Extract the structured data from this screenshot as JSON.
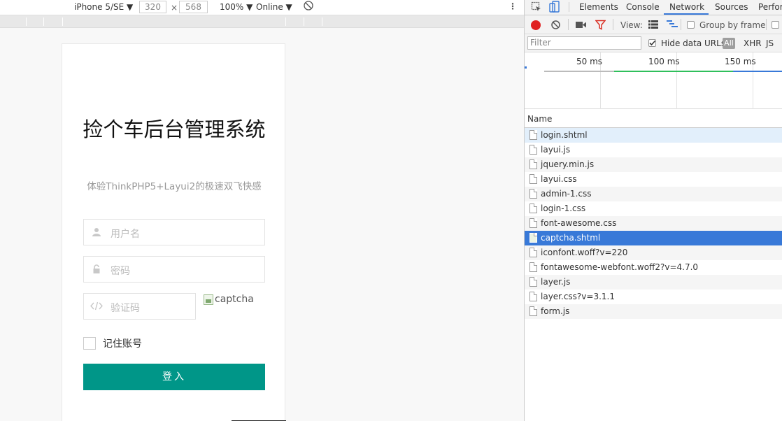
{
  "emulator": {
    "device": "iPhone 5/SE",
    "width": "320",
    "times": "×",
    "height": "568",
    "zoom": "100%",
    "network": "Online"
  },
  "login": {
    "title": "捡个车后台管理系统",
    "subtitle": "体验ThinkPHP5+Layui2的极速双飞快感",
    "username_placeholder": "用户名",
    "password_placeholder": "密码",
    "captcha_placeholder": "验证码",
    "captcha_alt": "captcha",
    "remember_label": "记住账号",
    "submit_label": "登入"
  },
  "devtools": {
    "tabs": [
      "Elements",
      "Console",
      "Network",
      "Sources",
      "Perfor"
    ],
    "active_tab": "Network",
    "view_label": "View:",
    "group_by_frame": "Group by frame",
    "filter_placeholder": "Filter",
    "hide_data_urls": "Hide data URLs",
    "type_filters": [
      "All",
      "XHR",
      "JS"
    ],
    "timeline_labels": [
      "50 ms",
      "100 ms",
      "150 ms"
    ],
    "column_name": "Name",
    "requests": [
      "login.shtml",
      "layui.js",
      "jquery.min.js",
      "layui.css",
      "admin-1.css",
      "login-1.css",
      "font-awesome.css",
      "captcha.shtml",
      "iconfont.woff?v=220",
      "fontawesome-webfont.woff2?v=4.7.0",
      "layer.js",
      "layer.css?v=3.1.1",
      "form.js"
    ],
    "selected_request": "captcha.shtml",
    "colors": {
      "accent": "#3879d8",
      "record": "#e02020",
      "filter_icon": "#d93025",
      "submit": "#009688"
    }
  }
}
